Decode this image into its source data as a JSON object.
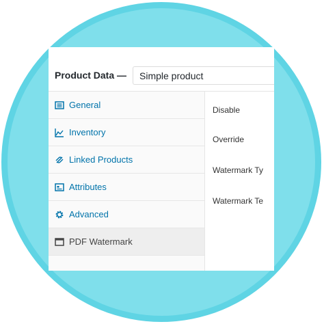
{
  "header": {
    "label": "Product Data —",
    "product_type": "Simple product"
  },
  "tabs": [
    {
      "label": "General",
      "icon": "general-icon"
    },
    {
      "label": "Inventory",
      "icon": "inventory-icon"
    },
    {
      "label": "Linked Products",
      "icon": "link-icon"
    },
    {
      "label": "Attributes",
      "icon": "attributes-icon"
    },
    {
      "label": "Advanced",
      "icon": "gear-icon"
    },
    {
      "label": "PDF Watermark",
      "icon": "window-icon",
      "active": true
    }
  ],
  "fields": [
    {
      "label": "Disable"
    },
    {
      "label": "Override"
    },
    {
      "label": "Watermark Ty"
    },
    {
      "label": "Watermark Te"
    }
  ],
  "colors": {
    "ring": "#5fd4e4",
    "circle": "#7fdfeb",
    "link": "#0073aa",
    "active_tab_bg": "#eeeeee"
  }
}
